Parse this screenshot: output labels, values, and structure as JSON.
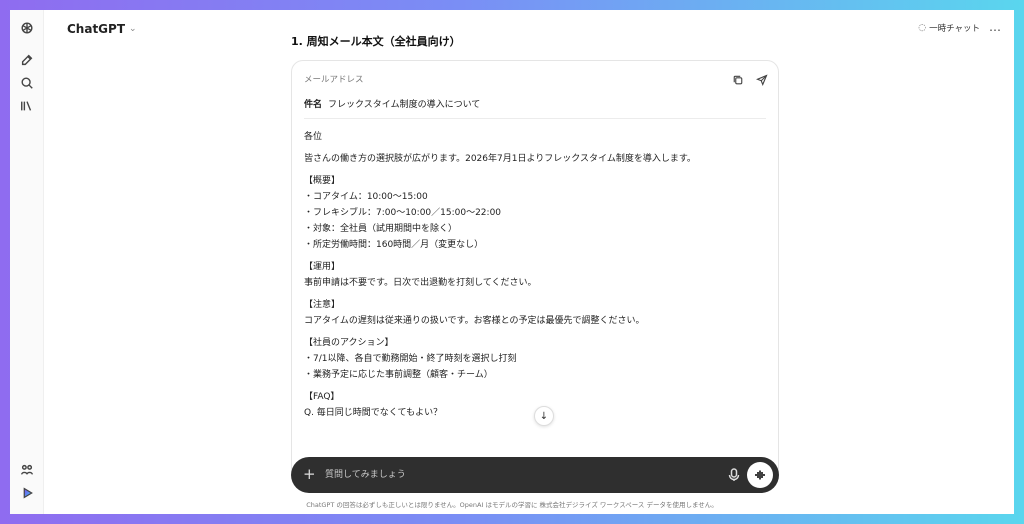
{
  "app": {
    "model_name": "ChatGPT",
    "temporary_chat_label": "一時チャット",
    "more_label": "…"
  },
  "response": {
    "heading": "1. 周知メール本文（全社員向け）"
  },
  "email_card": {
    "label": "メールアドレス",
    "subject_key": "件名",
    "subject_value": "フレックスタイム制度の導入について",
    "body": [
      [
        "各位"
      ],
      [
        "皆さんの働き方の選択肢が広がります。2026年7月1日よりフレックスタイム制度を導入します。"
      ],
      [
        "【概要】",
        "・コアタイム：10:00〜15:00",
        "・フレキシブル：7:00〜10:00／15:00〜22:00",
        "・対象：全社員（試用期間中を除く）",
        "・所定労働時間：160時間／月（変更なし）"
      ],
      [
        "【運用】",
        "事前申請は不要です。日次で出退勤を打刻してください。"
      ],
      [
        "【注意】",
        "コアタイムの遅刻は従来通りの扱いです。お客様との予定は最優先で調整ください。"
      ],
      [
        "【社員のアクション】",
        "・7/1以降、各自で勤務開始・終了時刻を選択し打刻",
        "・業務予定に応じた事前調整（顧客・チーム）"
      ],
      [
        "【FAQ】",
        "Q. 毎日同じ時間でなくてもよい？"
      ]
    ]
  },
  "composer": {
    "placeholder": "質問してみましょう"
  },
  "footer": {
    "disclaimer": "ChatGPT の回答は必ずしも正しいとは限りません。OpenAI はモデルの学習に 株式会社デジライズ ワークスペース データを使用しません。"
  }
}
